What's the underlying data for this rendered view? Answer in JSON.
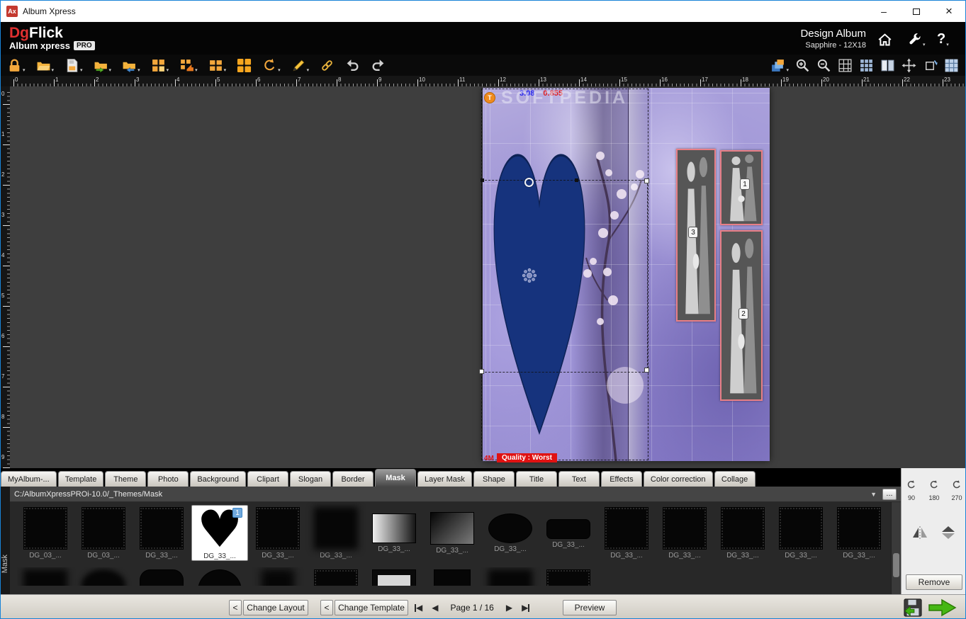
{
  "window": {
    "title": "Album Xpress",
    "app_icon_text": "Ax"
  },
  "header": {
    "logo_part1": "Dg",
    "logo_part2": "Flick",
    "logo_sub": "Album xpress",
    "logo_badge": "PRO",
    "mode_title": "Design Album",
    "mode_subtitle": "Sapphire - 12X18",
    "help_label": "?"
  },
  "toolbar": {
    "left_icons": [
      {
        "name": "lock",
        "dropdown": true
      },
      {
        "name": "folder-open",
        "dropdown": true
      },
      {
        "name": "save-file",
        "dropdown": true
      },
      {
        "name": "folder-export",
        "dropdown": true
      },
      {
        "name": "folder-import",
        "dropdown": true
      },
      {
        "name": "grid-settings",
        "dropdown": true
      },
      {
        "name": "grid-snap",
        "dropdown": true
      },
      {
        "name": "layout-small",
        "dropdown": true
      },
      {
        "name": "layout-large",
        "dropdown": false
      },
      {
        "name": "rotate-ccw",
        "dropdown": true
      },
      {
        "name": "edit-pen",
        "dropdown": true
      },
      {
        "name": "link",
        "dropdown": false
      },
      {
        "name": "undo",
        "dropdown": false
      },
      {
        "name": "redo",
        "dropdown": false
      }
    ],
    "right_icons": [
      {
        "name": "layers",
        "dropdown": true
      },
      {
        "name": "zoom-in",
        "dropdown": false
      },
      {
        "name": "zoom-out",
        "dropdown": false
      },
      {
        "name": "show-grid",
        "dropdown": false
      },
      {
        "name": "grid-blue",
        "dropdown": false
      },
      {
        "name": "pages-spread",
        "dropdown": false
      },
      {
        "name": "transform-move",
        "dropdown": false
      },
      {
        "name": "transform-rotate",
        "dropdown": false
      },
      {
        "name": "cells-grid",
        "dropdown": false
      }
    ]
  },
  "rulers": {
    "horizontal": [
      "0",
      "1",
      "2",
      "3",
      "4",
      "5",
      "6",
      "7",
      "8",
      "9",
      "10",
      "11",
      "12",
      "13",
      "14",
      "15",
      "16",
      "17",
      "18",
      "19",
      "20",
      "21",
      "22",
      "23"
    ],
    "vertical": [
      "0",
      "1",
      "2",
      "3",
      "4",
      "5",
      "6",
      "7",
      "8",
      "9"
    ]
  },
  "canvas": {
    "watermark": "SOFTPEDIA",
    "measure_blue": "3.08",
    "measure_red": "0.855",
    "corner_handle": "T",
    "size_label": "4M",
    "quality_label": "Quality : Worst",
    "frames": [
      {
        "num": "1"
      },
      {
        "num": "2"
      },
      {
        "num": "3"
      }
    ]
  },
  "tabs": [
    {
      "label": "MyAlbum-...",
      "selected": false
    },
    {
      "label": "Template",
      "selected": false
    },
    {
      "label": "Theme",
      "selected": false
    },
    {
      "label": "Photo",
      "selected": false
    },
    {
      "label": "Background",
      "selected": false
    },
    {
      "label": "Clipart",
      "selected": false
    },
    {
      "label": "Slogan",
      "selected": false
    },
    {
      "label": "Border",
      "selected": false
    },
    {
      "label": "Mask",
      "selected": true
    },
    {
      "label": "Layer Mask",
      "selected": false
    },
    {
      "label": "Shape",
      "selected": false
    },
    {
      "label": "Title",
      "selected": false
    },
    {
      "label": "Text",
      "selected": false
    },
    {
      "label": "Effects",
      "selected": false
    },
    {
      "label": "Color correction",
      "selected": false
    },
    {
      "label": "Collage",
      "selected": false
    }
  ],
  "path_bar": {
    "path": "C:/AlbumXpressPROi-10.0/_Themes/Mask",
    "more_label": "..."
  },
  "masks": {
    "row1": [
      {
        "label": "DG_03_...",
        "shape": "rough-square"
      },
      {
        "label": "DG_03_...",
        "shape": "rough-square"
      },
      {
        "label": "DG_33_...",
        "shape": "rough-square"
      },
      {
        "label": "DG_33_...",
        "shape": "heart",
        "selected": true,
        "badge": "1"
      },
      {
        "label": "DG_33_...",
        "shape": "rough-square"
      },
      {
        "label": "DG_33_...",
        "shape": "blur-square"
      },
      {
        "label": "DG_33_...",
        "shape": "gradient-h"
      },
      {
        "label": "DG_33_...",
        "shape": "gradient-v"
      },
      {
        "label": "DG_33_...",
        "shape": "oval"
      },
      {
        "label": "DG_33_...",
        "shape": "bar"
      },
      {
        "label": "DG_33_...",
        "shape": "rough-square"
      },
      {
        "label": "DG_33_...",
        "shape": "rough-square"
      },
      {
        "label": "DG_33_...",
        "shape": "rough-square"
      },
      {
        "label": "DG_33_...",
        "shape": "rough-square"
      },
      {
        "label": "DG_33_...",
        "shape": "rough-square"
      }
    ],
    "row2": [
      {
        "shape": "blur-square"
      },
      {
        "shape": "blur-oval"
      },
      {
        "shape": "rounded-square"
      },
      {
        "shape": "circle"
      },
      {
        "shape": "blur-small"
      },
      {
        "shape": "rough-bar"
      },
      {
        "shape": "frame-square"
      },
      {
        "shape": "bar-small"
      },
      {
        "shape": "blur-square"
      },
      {
        "shape": "rough-square"
      }
    ]
  },
  "side_panel": {
    "rotate_labels": [
      "90",
      "180",
      "270"
    ],
    "remove_label": "Remove"
  },
  "bottom_bar": {
    "panel_label": "Mask",
    "back_arrow_label": "<",
    "change_layout": "Change Layout",
    "change_template": "Change Template",
    "page_label": "Page 1 / 16",
    "preview": "Preview"
  },
  "colors": {
    "accent_orange": "#f3a73c",
    "status_red": "#e01212",
    "heart_blue": "#16337d",
    "frame_pink": "#e87f86",
    "next_green": "#46b714"
  }
}
